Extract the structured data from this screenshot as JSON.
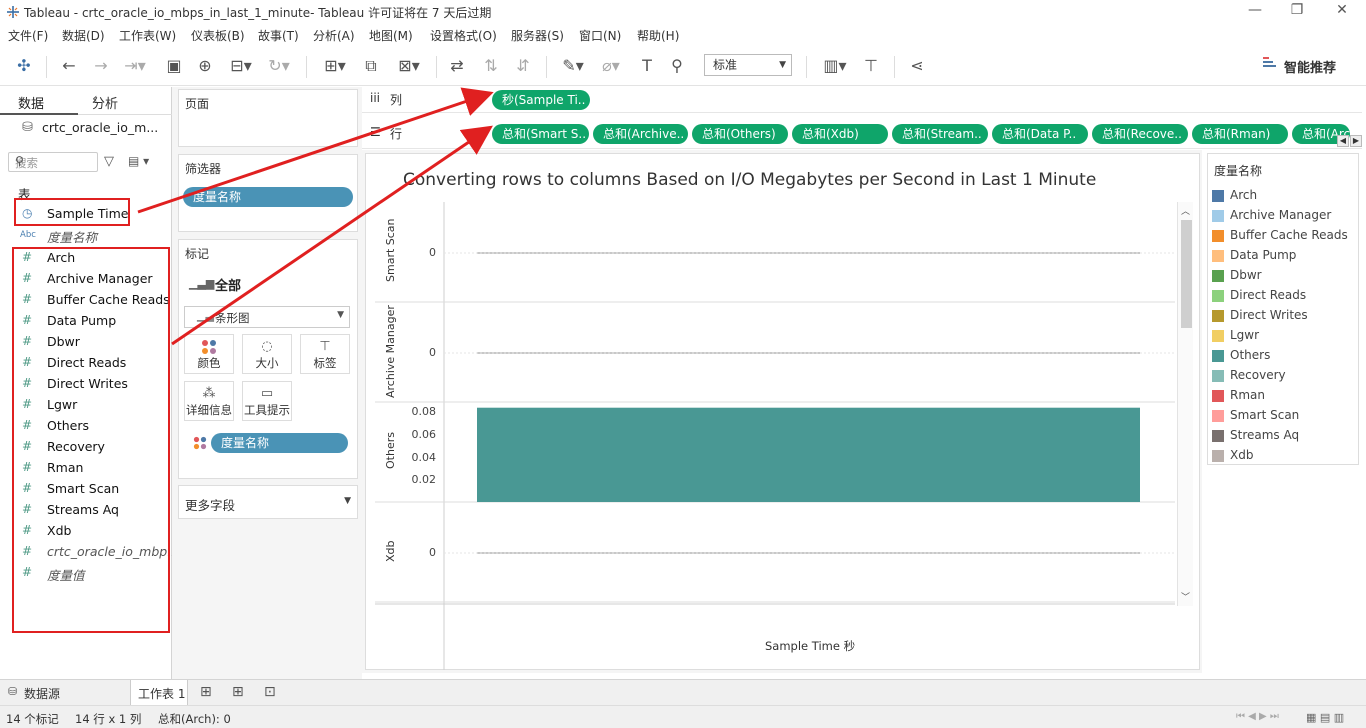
{
  "window": {
    "title": "Tableau - crtc_oracle_io_mbps_in_last_1_minute- Tableau 许可证将在 7 天后过期",
    "minimize": "—",
    "restore": "❐",
    "close": "✕"
  },
  "menu": [
    "文件(F)",
    "数据(D)",
    "工作表(W)",
    "仪表板(B)",
    "故事(T)",
    "分析(A)",
    "地图(M)",
    "设置格式(O)",
    "服务器(S)",
    "窗口(N)",
    "帮助(H)"
  ],
  "toolbar": {
    "fit_select": "标准",
    "smart_recommend": "智能推荐"
  },
  "data_pane": {
    "tab_data": "数据",
    "tab_analysis": "分析",
    "collapse_glyph": "‹",
    "datasource": "crtc_oracle_io_m...",
    "search_placeholder": "搜索",
    "table_heading": "表",
    "dimensions": [
      {
        "icon": "calendar-clock",
        "label": "Sample Time"
      },
      {
        "icon": "abc",
        "label": "度量名称"
      }
    ],
    "measures": [
      "Arch",
      "Archive Manager",
      "Buffer Cache Reads",
      "Data Pump",
      "Dbwr",
      "Direct Reads",
      "Direct Writes",
      "Lgwr",
      "Others",
      "Recovery",
      "Rman",
      "Smart Scan",
      "Streams Aq",
      "Xdb"
    ],
    "extra": [
      "crtc_oracle_io_mbp...",
      "度量值"
    ]
  },
  "cards": {
    "pages_title": "页面",
    "filters_title": "筛选器",
    "filter_pill": "度量名称",
    "marks_title": "标记",
    "marks_all": "全部",
    "mark_type": "条形图",
    "mark_buttons": [
      "颜色",
      "大小",
      "标签",
      "详细信息",
      "工具提示"
    ],
    "color_pill": "度量名称",
    "more_fields": "更多字段"
  },
  "shelves": {
    "columns_label": "列",
    "rows_label": "行",
    "columns_pills": [
      "秒(Sample Ti.."
    ],
    "rows_pills": [
      "总和(Smart S..",
      "总和(Archive..",
      "总和(Others)",
      "总和(Xdb)",
      "总和(Stream..",
      "总和(Data P..",
      "总和(Recove..",
      "总和(Rman)",
      "总和(Arch)"
    ]
  },
  "chart": {
    "title": "Converting rows to columns Based on I/O Megabytes per Second in Last 1 Minute",
    "xlabel": "Sample Time 秒",
    "panels": [
      {
        "label": "Smart Scan",
        "ticks": [
          "0"
        ]
      },
      {
        "label": "Archive Manager",
        "ticks": [
          "0"
        ]
      },
      {
        "label": "Others",
        "ticks": [
          "0.08",
          "0.06",
          "0.04",
          "0.02"
        ]
      },
      {
        "label": "Xdb",
        "ticks": [
          "0"
        ]
      }
    ]
  },
  "chart_data": {
    "type": "bar",
    "title": "Converting rows to columns Based on I/O Megabytes per Second in Last 1 Minute",
    "xlabel": "Sample Time 秒",
    "series": [
      {
        "name": "Smart Scan",
        "values": [
          0
        ]
      },
      {
        "name": "Archive Manager",
        "values": [
          0
        ]
      },
      {
        "name": "Others",
        "values": [
          0.082
        ]
      },
      {
        "name": "Xdb",
        "values": [
          0
        ]
      }
    ],
    "others_ylim": [
      0,
      0.08
    ]
  },
  "legend": {
    "title": "度量名称",
    "items": [
      {
        "label": "Arch",
        "color": "#4e79a7"
      },
      {
        "label": "Archive Manager",
        "color": "#a0cbe8"
      },
      {
        "label": "Buffer Cache Reads",
        "color": "#f28e2b"
      },
      {
        "label": "Data Pump",
        "color": "#ffbe7d"
      },
      {
        "label": "Dbwr",
        "color": "#59a14f"
      },
      {
        "label": "Direct Reads",
        "color": "#8cd17d"
      },
      {
        "label": "Direct Writes",
        "color": "#b6992d"
      },
      {
        "label": "Lgwr",
        "color": "#f1ce63"
      },
      {
        "label": "Others",
        "color": "#499894"
      },
      {
        "label": "Recovery",
        "color": "#86bcb6"
      },
      {
        "label": "Rman",
        "color": "#e15759"
      },
      {
        "label": "Smart Scan",
        "color": "#ff9d9a"
      },
      {
        "label": "Streams Aq",
        "color": "#79706e"
      },
      {
        "label": "Xdb",
        "color": "#bab0ac"
      }
    ]
  },
  "bottom": {
    "datasource_tab": "数据源",
    "sheet_tab": "工作表 1"
  },
  "status": {
    "marks": "14 个标记",
    "rows_cols": "14 行 x 1 列",
    "sum": "总和(Arch): 0"
  }
}
